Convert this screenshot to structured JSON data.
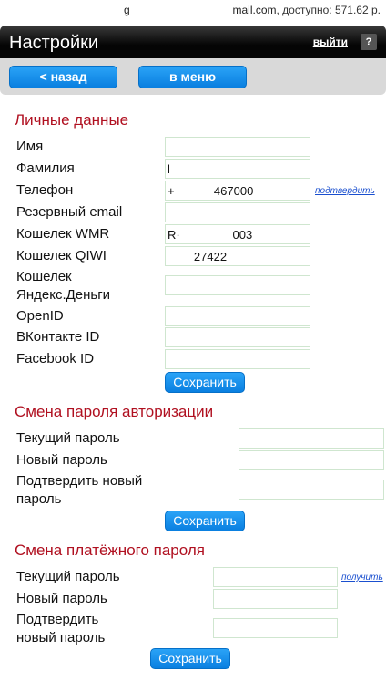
{
  "topbar": {
    "user": "g",
    "account_link": "mail.com",
    "balance_text": ", доступно: 571.62 р."
  },
  "header": {
    "title": "Настройки",
    "exit_label": "выйти",
    "help_label": "?"
  },
  "nav": {
    "back_label": "< назад",
    "menu_label": "в меню"
  },
  "personal": {
    "title": "Личные данные",
    "fields": [
      {
        "label": "Имя",
        "value": ""
      },
      {
        "label": "Фамилия",
        "value": "l"
      },
      {
        "label": "Телефон",
        "value": "+            467000"
      },
      {
        "label": "Резервный email",
        "value": ""
      },
      {
        "label": "Кошелек WMR",
        "value": "R·                003"
      },
      {
        "label": "Кошелек QIWI",
        "value": "        27422"
      },
      {
        "label": "Кошелек Яндекс.Деньги",
        "value": ""
      },
      {
        "label": "OpenID",
        "value": ""
      },
      {
        "label": "ВКонтакте ID",
        "value": ""
      },
      {
        "label": "Facebook ID",
        "value": ""
      }
    ],
    "confirm_link": "подтвердить",
    "save_label": "Сохранить"
  },
  "auth_password": {
    "title": "Смена пароля авторизации",
    "current_label": "Текущий пароль",
    "new_label": "Новый пароль",
    "confirm_label": "Подтвердить новый пароль",
    "save_label": "Сохранить"
  },
  "payment_password": {
    "title": "Смена платёжного пароля",
    "current_label": "Текущий пароль",
    "get_link": "получить",
    "new_label": "Новый пароль",
    "confirm_label": "Подтвердить новый пароль",
    "save_label": "Сохранить"
  }
}
